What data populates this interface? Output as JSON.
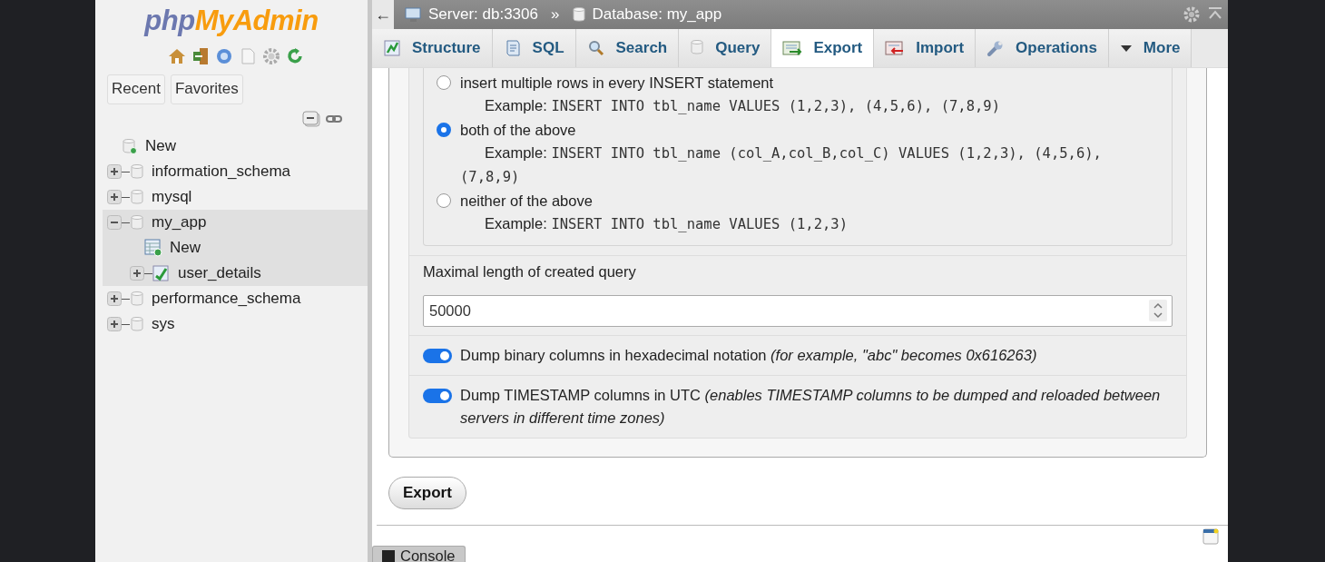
{
  "logo": {
    "part_1": "php",
    "part_2": "MyAdmin"
  },
  "sidebar_tabs": [
    {
      "label": "Recent"
    },
    {
      "label": "Favorites"
    }
  ],
  "tree": [
    {
      "label": "New",
      "kind": "new"
    },
    {
      "label": "information_schema",
      "kind": "database",
      "expanded": false,
      "selected": false
    },
    {
      "label": "mysql",
      "kind": "database",
      "expanded": false,
      "selected": false
    },
    {
      "label": "my_app",
      "kind": "database",
      "expanded": true,
      "selected": true,
      "children": [
        {
          "label": "New",
          "kind": "new_table"
        },
        {
          "label": "user_details",
          "kind": "table",
          "expanded": false
        }
      ]
    },
    {
      "label": "performance_schema",
      "kind": "database",
      "expanded": false,
      "selected": false
    },
    {
      "label": "sys",
      "kind": "database",
      "expanded": false,
      "selected": false
    }
  ],
  "breadcrumb": {
    "back": "←",
    "server": "Server: db:3306",
    "separator": "»",
    "database": "Database: my_app"
  },
  "tabs": [
    {
      "label": "Structure",
      "selected": false
    },
    {
      "label": "SQL",
      "selected": false
    },
    {
      "label": "Search",
      "selected": false
    },
    {
      "label": "Query",
      "selected": false
    },
    {
      "label": "Export",
      "selected": true
    },
    {
      "label": "Import",
      "selected": false
    },
    {
      "label": "Operations",
      "selected": false
    },
    {
      "label": "More",
      "selected": false
    }
  ],
  "insert_options": [
    {
      "label": "insert multiple rows in every INSERT statement",
      "example_label": "Example:",
      "example_code": "INSERT INTO tbl_name VALUES (1,2,3), (4,5,6), (7,8,9)",
      "selected": false
    },
    {
      "label": "both of the above",
      "example_label": "Example:",
      "example_code": "INSERT INTO tbl_name (col_A,col_B,col_C) VALUES (1,2,3), (4,5,6), (7,8,9)",
      "selected": true
    },
    {
      "label": "neither of the above",
      "example_label": "Example:",
      "example_code": "INSERT INTO tbl_name VALUES (1,2,3)",
      "selected": false
    }
  ],
  "max_query_length": {
    "label": "Maximal length of created query",
    "value": "50000"
  },
  "toggles": [
    {
      "label": "Dump binary columns in hexadecimal notation *(for example, \"abc\" becomes 0x616263)*",
      "on": true
    },
    {
      "label": "Dump TIMESTAMP columns in UTC *(enables TIMESTAMP columns to be dumped and reloaded between servers in different time zones)*",
      "on": true
    }
  ],
  "export_button": "Export",
  "console": "Console"
}
